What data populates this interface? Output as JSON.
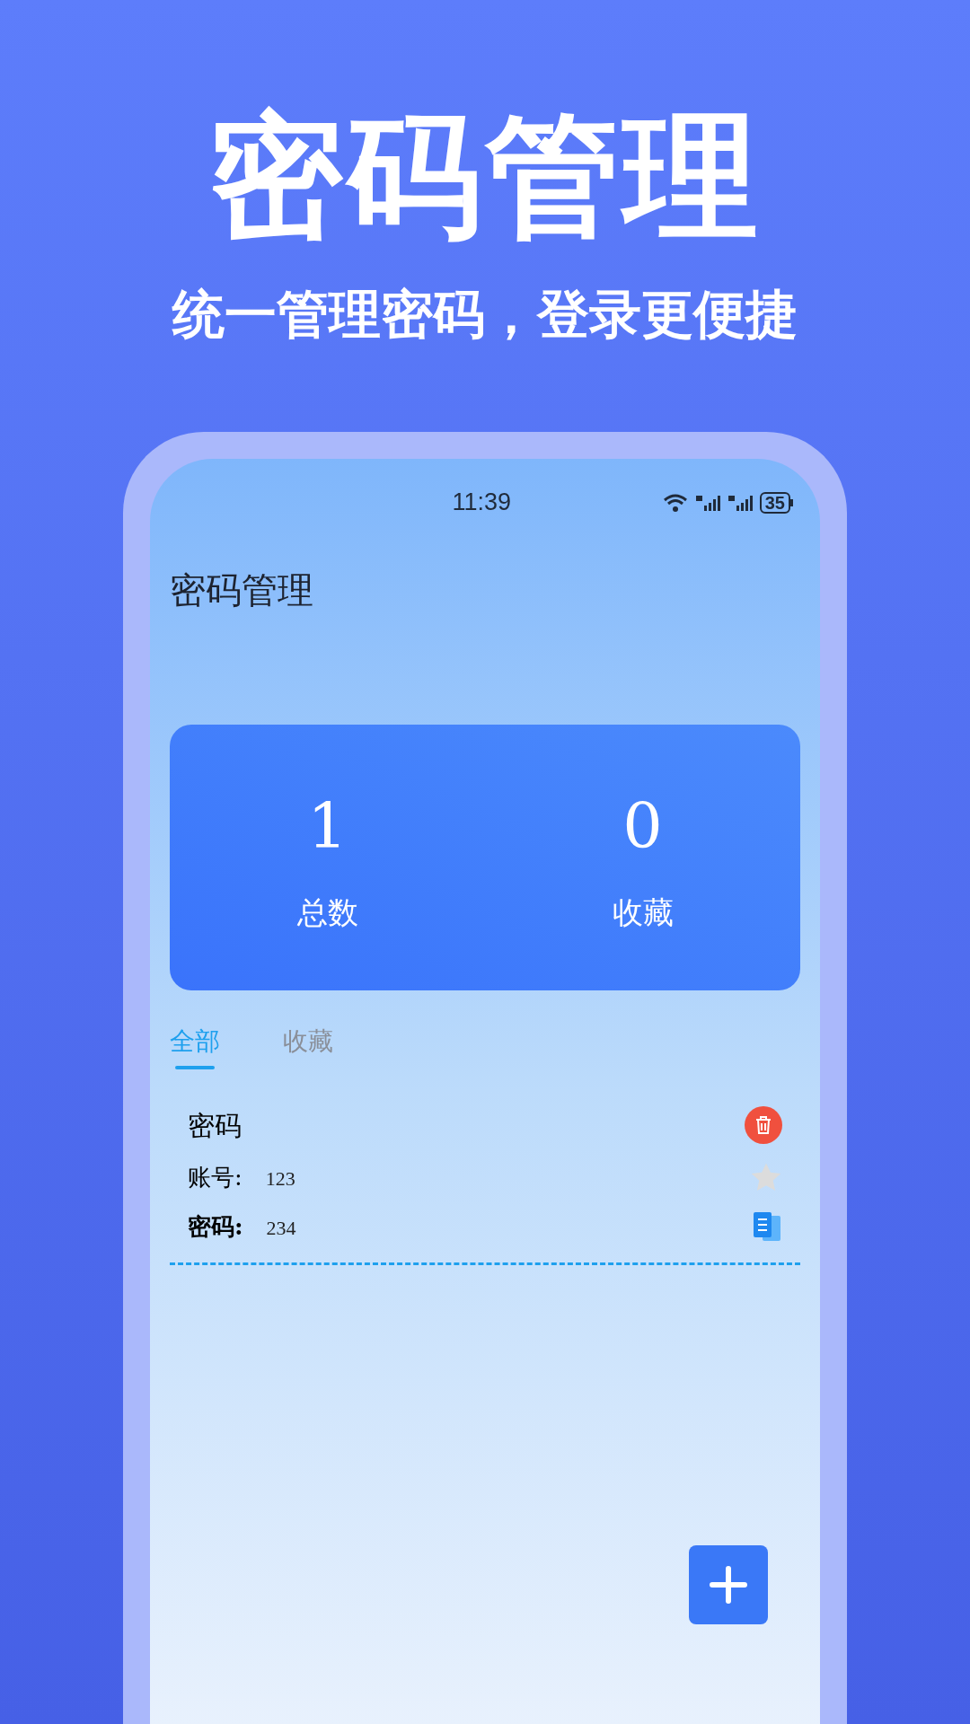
{
  "headline": "密码管理",
  "subtitle": "统一管理密码，登录更便捷",
  "status_bar": {
    "time": "11:39",
    "battery": "35"
  },
  "app_title": "密码管理",
  "stats": [
    {
      "value": "1",
      "label": "总数"
    },
    {
      "value": "0",
      "label": "收藏"
    }
  ],
  "tabs": [
    {
      "label": "全部",
      "selected": true
    },
    {
      "label": "收藏",
      "selected": false
    }
  ],
  "entries": [
    {
      "title": "密码",
      "favorite": false,
      "fields": [
        {
          "label": "账号:",
          "value": "123",
          "bold": false
        },
        {
          "label": "密码:",
          "value": "234",
          "bold": true
        }
      ]
    }
  ]
}
